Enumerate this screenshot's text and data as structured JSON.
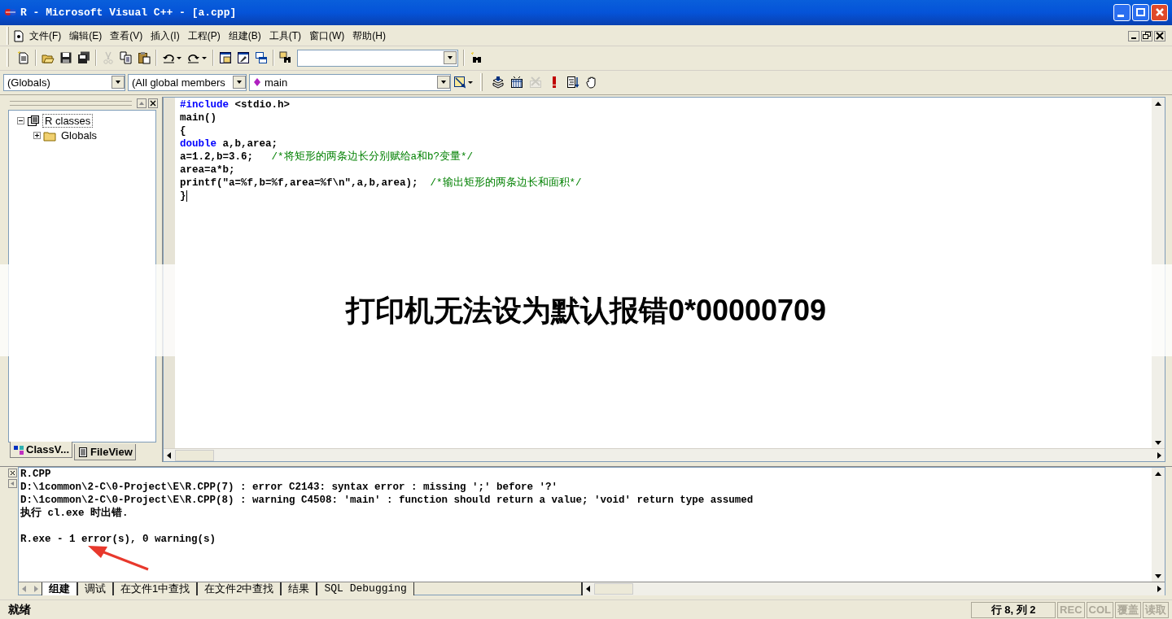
{
  "window": {
    "title": "R - Microsoft Visual C++ - [a.cpp]"
  },
  "menu": [
    {
      "label": "文件(F)"
    },
    {
      "label": "编辑(E)"
    },
    {
      "label": "查看(V)"
    },
    {
      "label": "插入(I)"
    },
    {
      "label": "工程(P)"
    },
    {
      "label": "组建(B)"
    },
    {
      "label": "工具(T)"
    },
    {
      "label": "窗口(W)"
    },
    {
      "label": "帮助(H)"
    }
  ],
  "toolbar": [
    {
      "kind": "new",
      "disabled": false
    },
    {
      "kind": "sep"
    },
    {
      "kind": "open",
      "disabled": false
    },
    {
      "kind": "save",
      "disabled": false
    },
    {
      "kind": "saveall",
      "disabled": false
    },
    {
      "kind": "sep"
    },
    {
      "kind": "cut",
      "disabled": true
    },
    {
      "kind": "copy",
      "disabled": false
    },
    {
      "kind": "paste",
      "disabled": false
    },
    {
      "kind": "sep"
    },
    {
      "kind": "undo",
      "disabled": false
    },
    {
      "kind": "redo",
      "disabled": false
    },
    {
      "kind": "sep"
    },
    {
      "kind": "workspace",
      "disabled": false
    },
    {
      "kind": "output",
      "disabled": false
    },
    {
      "kind": "windows",
      "disabled": false
    },
    {
      "kind": "sep"
    },
    {
      "kind": "findfiles",
      "disabled": false
    },
    {
      "kind": "findcombo"
    },
    {
      "kind": "sep"
    },
    {
      "kind": "find",
      "disabled": false
    }
  ],
  "wizard_bar": {
    "class_combo": "(Globals)",
    "filter_combo": "(All global members",
    "member_combo": "main"
  },
  "build_toolbar": [
    {
      "kind": "compile",
      "disabled": false
    },
    {
      "kind": "build",
      "disabled": false
    },
    {
      "kind": "stop",
      "disabled": true
    },
    {
      "kind": "execute",
      "disabled": false
    },
    {
      "kind": "go",
      "disabled": false
    },
    {
      "kind": "breakpoint",
      "disabled": false
    }
  ],
  "workspace": {
    "tree": [
      {
        "label": "R classes",
        "selected": true,
        "expanded": true,
        "children": [
          {
            "label": "Globals",
            "selected": false,
            "expanded": false
          }
        ]
      }
    ],
    "tabs": [
      {
        "label": "ClassV...",
        "selected": true
      },
      {
        "label": "FileView",
        "selected": false
      }
    ]
  },
  "editor": {
    "lines": [
      [
        {
          "kind": "keyword",
          "text": "#include"
        },
        {
          "kind": "plain",
          "text": " <stdio.h>"
        }
      ],
      [
        {
          "kind": "plain",
          "text": "main()"
        }
      ],
      [
        {
          "kind": "plain",
          "text": "{"
        }
      ],
      [
        {
          "kind": "keyword",
          "text": "double"
        },
        {
          "kind": "plain",
          "text": " a,b,area;"
        }
      ],
      [
        {
          "kind": "plain",
          "text": "a=1.2,b=3.6;   "
        },
        {
          "kind": "comment",
          "text": "/*将矩形的两条边长分别赋给a和b?变量*/"
        }
      ],
      [
        {
          "kind": "plain",
          "text": "area=a*b;"
        }
      ],
      [
        {
          "kind": "plain",
          "text": "printf(\"a=%f,b=%f,area=%f\\n\",a,b,area);  "
        },
        {
          "kind": "comment",
          "text": "/*输出矩形的两条边长和面积*/"
        }
      ],
      [
        {
          "kind": "plain",
          "text": "}"
        }
      ]
    ]
  },
  "output": {
    "lines": [
      {
        "text": "R.CPP",
        "gap_before": false
      },
      {
        "text": "D:\\1common\\2-C\\0-Project\\E\\R.CPP(7) : error C2143: syntax error : missing ';' before '?'",
        "gap_before": false
      },
      {
        "text": "D:\\1common\\2-C\\0-Project\\E\\R.CPP(8) : warning C4508: 'main' : function should return a value; 'void' return type assumed",
        "gap_before": false
      },
      {
        "text": "执行 cl.exe 时出错.",
        "gap_before": false
      },
      {
        "text": "R.exe - 1 error(s), 0 warning(s)",
        "gap_before": true
      }
    ],
    "tabs": [
      {
        "label": "组建",
        "selected": true
      },
      {
        "label": "调试",
        "selected": false
      },
      {
        "label": "在文件1中查找",
        "selected": false
      },
      {
        "label": "在文件2中查找",
        "selected": false
      },
      {
        "label": "结果",
        "selected": false
      },
      {
        "label": "SQL Debugging",
        "selected": false
      }
    ]
  },
  "status_bar": {
    "message": "就绪",
    "position": "行 8, 列 2",
    "indicators": [
      {
        "label": "REC",
        "disabled": true
      },
      {
        "label": "COL",
        "disabled": true
      },
      {
        "label": "覆盖",
        "disabled": true
      },
      {
        "label": "读取",
        "disabled": true
      }
    ]
  },
  "overlay_banner": {
    "text": "打印机无法设为默认报错0*00000709"
  }
}
